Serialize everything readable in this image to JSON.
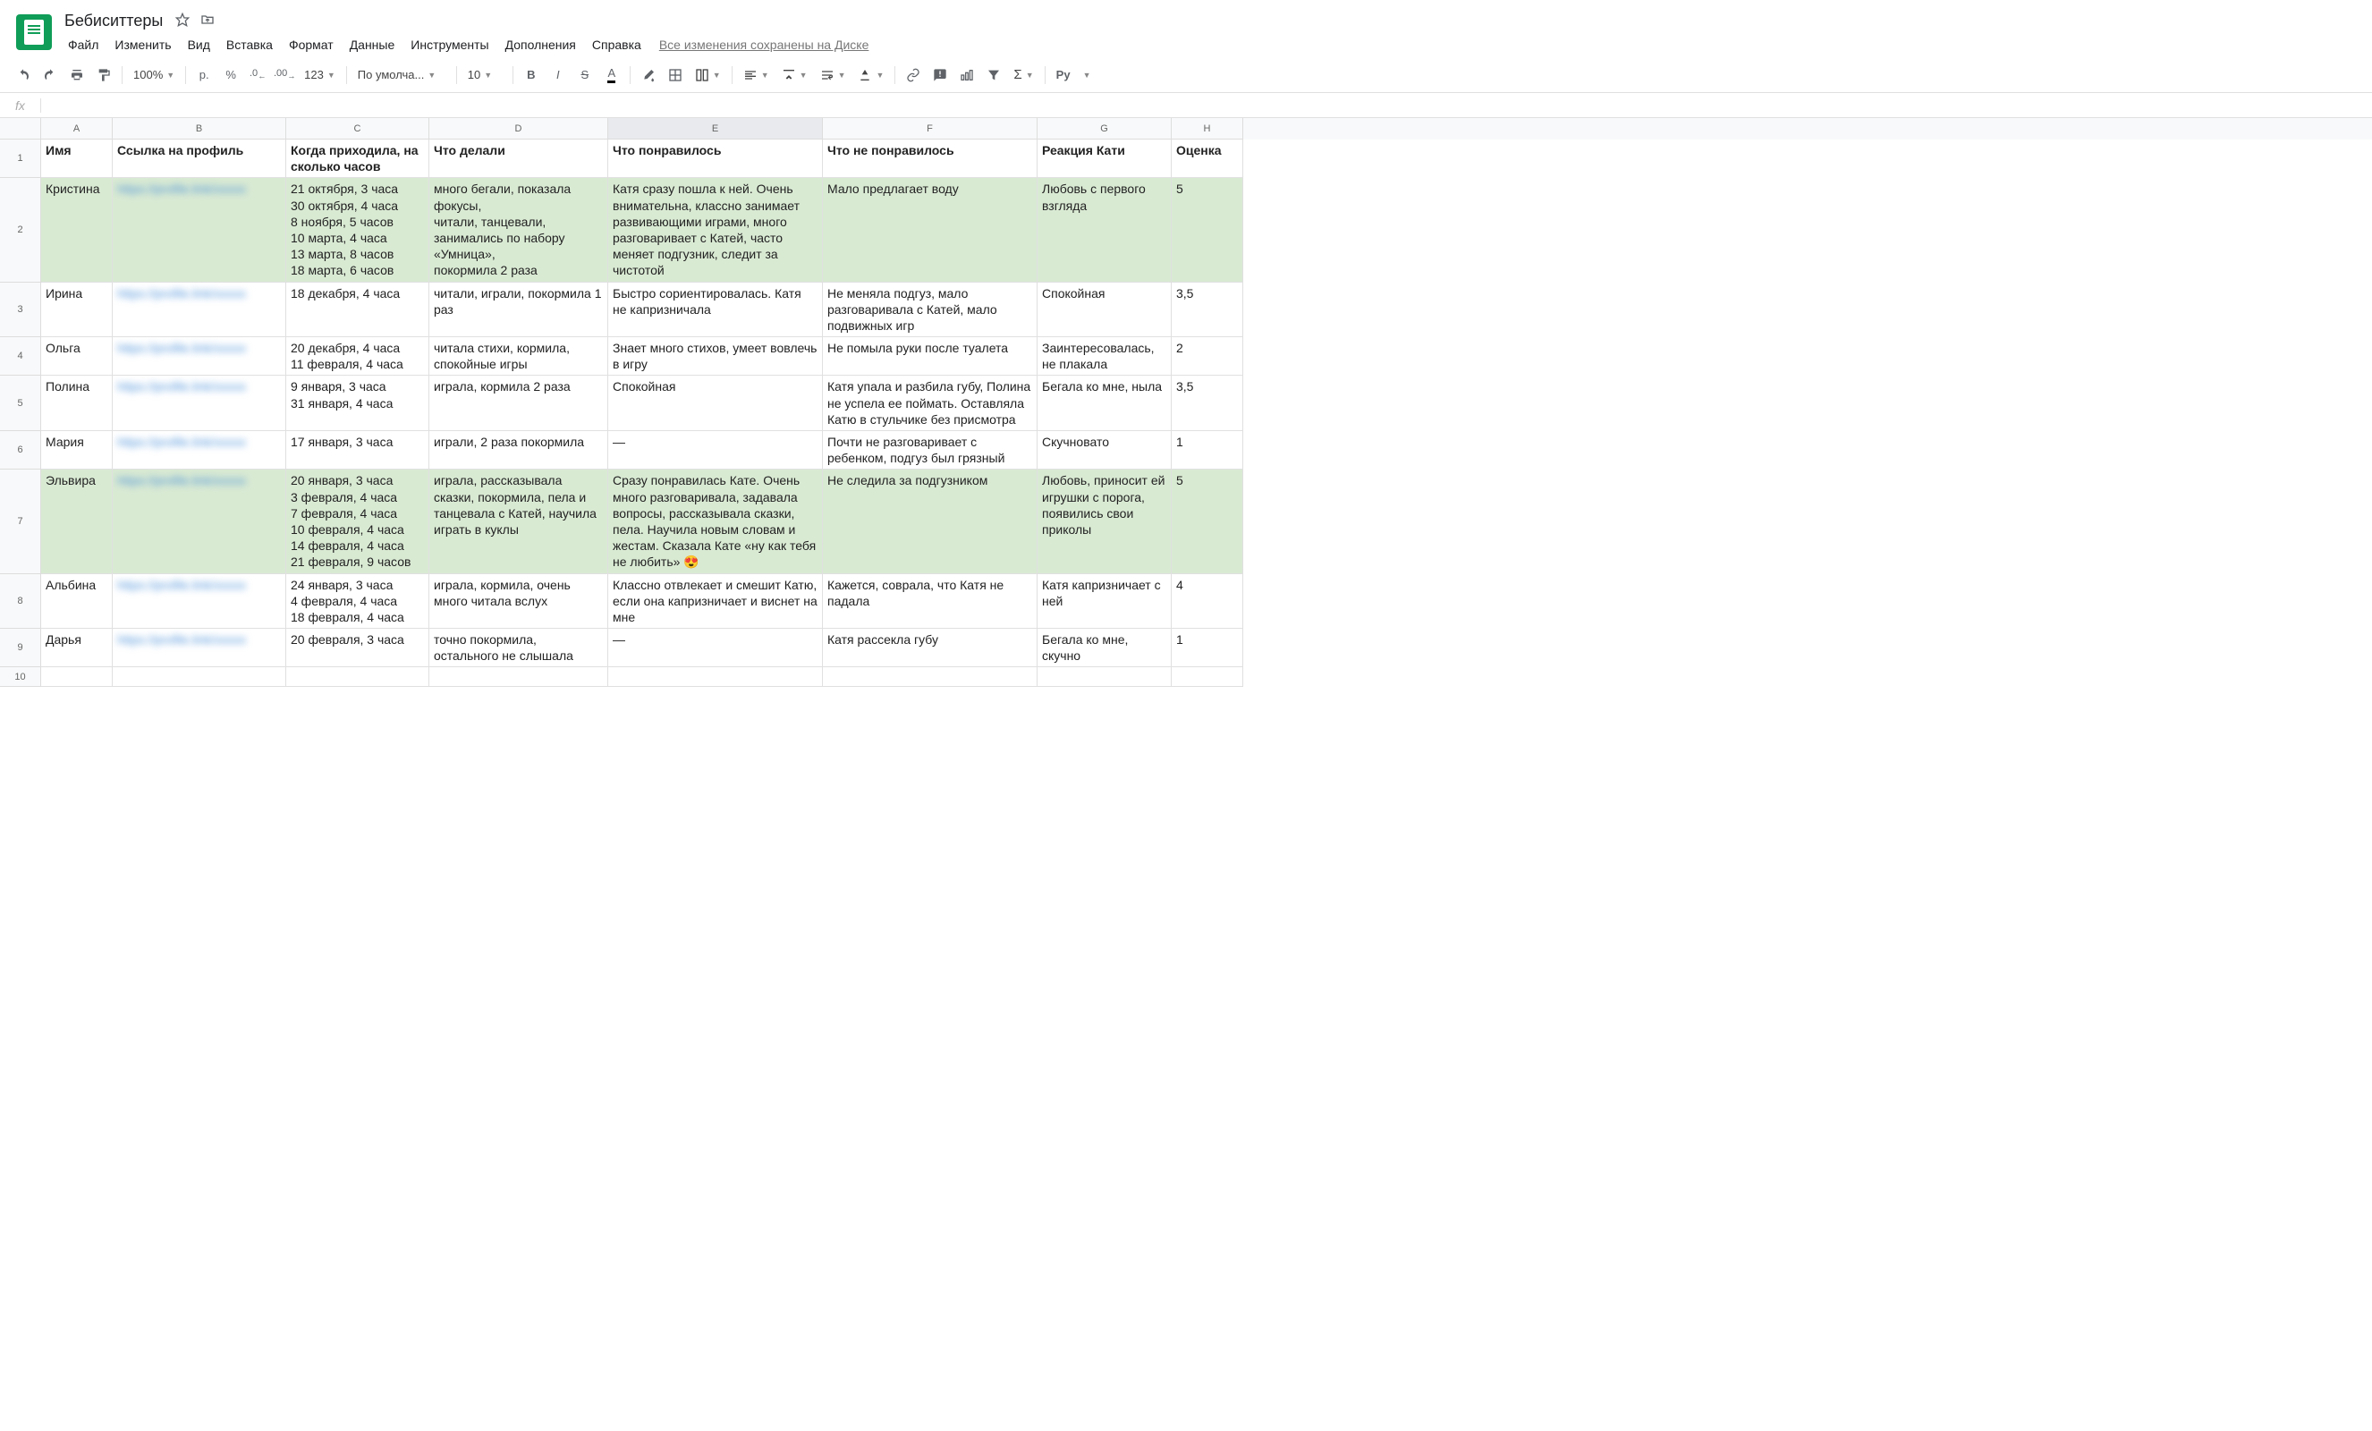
{
  "doc": {
    "title": "Бебиситтеры"
  },
  "menubar": [
    "Файл",
    "Изменить",
    "Вид",
    "Вставка",
    "Формат",
    "Данные",
    "Инструменты",
    "Дополнения",
    "Справка"
  ],
  "save_status": "Все изменения сохранены на Диске",
  "toolbar": {
    "zoom": "100%",
    "currency": "р.",
    "percent": "%",
    "dec_dec": ".0",
    "dec_inc": ".00",
    "numfmt": "123",
    "font": "По умолча...",
    "fontsize": "10"
  },
  "columns": [
    "A",
    "B",
    "C",
    "D",
    "E",
    "F",
    "G",
    "H"
  ],
  "selected_col": "E",
  "headers": [
    "Имя",
    "Ссылка на профиль",
    "Когда приходила, на сколько часов",
    "Что делали",
    "Что понравилось",
    "Что не понравилось",
    "Реакция Кати",
    "Оценка"
  ],
  "rows": [
    {
      "green": true,
      "cells": [
        "Кристина",
        "blurred",
        "21 октября, 3 часа\n30 октября, 4 часа\n8 ноября, 5 часов\n10 марта, 4 часа\n13 марта, 8 часов\n18 марта, 6 часов",
        "много бегали, показала фокусы,\nчитали, танцевали, занимались по набору «Умница»,\nпокормила 2 раза",
        "Катя сразу пошла к ней. Очень внимательна, классно занимает развивающими играми, много разговаривает с Катей, часто меняет подгузник, следит за чистотой",
        "Мало предлагает воду",
        "Любовь с первого взгляда",
        "5"
      ]
    },
    {
      "green": false,
      "cells": [
        "Ирина",
        "blurred",
        "18 декабря, 4 часа",
        "читали, играли, покормила 1 раз",
        "Быстро сориентировалась. Катя не капризничала",
        "Не меняла подгуз, мало разговаривала с Катей, мало подвижных игр",
        "Спокойная",
        "3,5"
      ]
    },
    {
      "green": false,
      "cells": [
        "Ольга",
        "blurred",
        "20 декабря, 4 часа\n11 февраля, 4 часа",
        "читала стихи, кормила, спокойные игры",
        "Знает много стихов, умеет вовлечь в игру",
        "Не помыла руки после туалета",
        "Заинтересовалась, не плакала",
        "2"
      ]
    },
    {
      "green": false,
      "cells": [
        "Полина",
        "blurred",
        "9 января, 3 часа\n31 января, 4 часа",
        "играла, кормила 2 раза",
        "Спокойная",
        "Катя упала и разбила губу, Полина не успела ее поймать. Оставляла Катю в стульчике без присмотра",
        "Бегала ко мне, ныла",
        "3,5"
      ]
    },
    {
      "green": false,
      "cells": [
        "Мария",
        "blurred",
        "17 января, 3 часа",
        "играли, 2 раза покормила",
        "—",
        "Почти не разговаривает с ребенком, подгуз был грязный",
        "Скучновато",
        "1"
      ]
    },
    {
      "green": true,
      "cells": [
        "Эльвира",
        "blurred",
        "20 января, 3 часа\n3 февраля, 4 часа\n7 февраля, 4 часа\n10 февраля, 4 часа\n14 февраля, 4 часа\n21 февраля, 9 часов",
        "играла, рассказывала сказки, покормила, пела и танцевала с Катей, научила играть в куклы",
        "Сразу понравилась Кате. Очень много разговаривала, задавала вопросы, рассказывала сказки, пела. Научила новым словам и жестам. Сказала Кате «ну как тебя не любить» 😍",
        "Не следила за подгузником",
        "Любовь, приносит ей игрушки с порога, появились свои приколы",
        "5"
      ]
    },
    {
      "green": false,
      "cells": [
        "Альбина",
        "blurred",
        "24 января, 3 часа\n4 февраля, 4 часа\n18 февраля, 4 часа",
        "играла, кормила, очень много читала вслух",
        "Классно отвлекает и смешит Катю, если она капризничает и виснет на мне",
        "Кажется, соврала, что Катя не падала",
        "Катя капризничает с ней",
        "4"
      ]
    },
    {
      "green": false,
      "cells": [
        "Дарья",
        "blurred",
        "20 февраля, 3 часа",
        "точно покормила, остального не слышала",
        "—",
        "Катя рассекла губу",
        "Бегала ко мне, скучно",
        "1"
      ]
    },
    {
      "green": false,
      "cells": [
        "",
        "",
        "",
        "",
        "",
        "",
        "",
        ""
      ]
    }
  ]
}
